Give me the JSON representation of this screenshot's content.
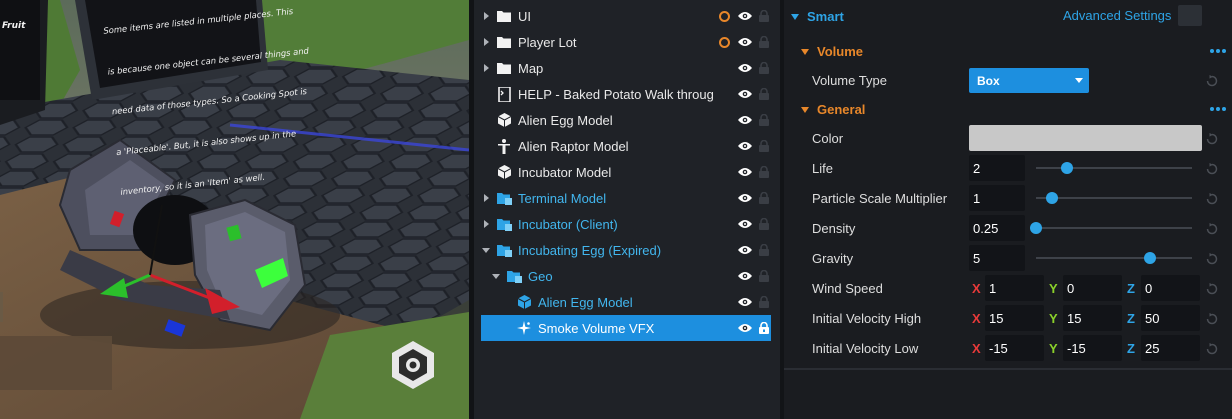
{
  "viewport": {
    "sign_lines": [
      "Some items are listed in multiple places. This",
      "is because one object can be several things and",
      "need data of those types. So a Cooking Spot is",
      "a 'Placeable'. But, it is also shows up in the",
      "inventory, so it is an 'Item' as well."
    ],
    "left_sign_fragment": "Fruit"
  },
  "hierarchy": {
    "rows": [
      {
        "label": "UI",
        "icon": "folder-icon",
        "expander": "collapsed",
        "status": "orange-ring",
        "locked": false,
        "blue": false
      },
      {
        "label": "Player Lot",
        "icon": "folder-icon",
        "expander": "collapsed",
        "status": "orange-ring",
        "locked": false,
        "blue": false
      },
      {
        "label": "Map",
        "icon": "folder-icon",
        "expander": "collapsed",
        "status": "",
        "locked": false,
        "blue": false
      },
      {
        "label": "HELP - Baked Potato Walk throug",
        "icon": "script-icon",
        "expander": "none",
        "status": "",
        "locked": false,
        "blue": false
      },
      {
        "label": "Alien Egg Model",
        "icon": "cube-icon",
        "expander": "none",
        "status": "",
        "locked": false,
        "blue": false
      },
      {
        "label": "Alien Raptor Model",
        "icon": "figure-icon",
        "expander": "none",
        "status": "",
        "locked": false,
        "blue": false
      },
      {
        "label": "Incubator Model",
        "icon": "cube-icon",
        "expander": "none",
        "status": "",
        "locked": false,
        "blue": false
      },
      {
        "label": "Terminal Model",
        "icon": "template-folder-icon",
        "expander": "collapsed",
        "status": "",
        "locked": false,
        "blue": true
      },
      {
        "label": "Incubator (Client)",
        "icon": "template-folder-icon",
        "expander": "collapsed",
        "status": "",
        "locked": false,
        "blue": true
      },
      {
        "label": "Incubating Egg (Expired)",
        "icon": "template-folder-icon",
        "expander": "expanded",
        "status": "",
        "locked": false,
        "blue": true
      },
      {
        "label": "Geo",
        "icon": "template-folder-icon",
        "expander": "expanded",
        "status": "",
        "locked": false,
        "blue": true
      },
      {
        "label": "Alien Egg Model",
        "icon": "cube-icon",
        "expander": "none",
        "status": "",
        "locked": false,
        "blue": true
      },
      {
        "label": "Smoke Volume VFX",
        "icon": "sparkle-icon",
        "expander": "none",
        "status": "",
        "locked": true,
        "blue": false,
        "selected": true
      }
    ]
  },
  "properties": {
    "smart_title": "Smart",
    "advanced_settings": "Advanced Settings",
    "volume_section": "Volume",
    "volume_type_label": "Volume Type",
    "volume_type_value": "Box",
    "general_section": "General",
    "color_label": "Color",
    "color_value": "#c8c8c8",
    "life_label": "Life",
    "life_value": "2",
    "life_slider": 0.2,
    "scale_label": "Particle Scale Multiplier",
    "scale_value": "1",
    "scale_slider": 0.1,
    "density_label": "Density",
    "density_value": "0.25",
    "density_slider": 0.0,
    "gravity_label": "Gravity",
    "gravity_value": "5",
    "gravity_slider": 0.73,
    "wind_label": "Wind Speed",
    "wind": {
      "x": "1",
      "y": "0",
      "z": "0"
    },
    "vel_high_label": "Initial Velocity High",
    "vel_high": {
      "x": "15",
      "y": "15",
      "z": "50"
    },
    "vel_low_label": "Initial Velocity Low",
    "vel_low": {
      "x": "-15",
      "y": "-15",
      "z": "25"
    },
    "axis_x": "X",
    "axis_y": "Y",
    "axis_z": "Z"
  },
  "colors": {
    "accent_blue": "#2ea4e6",
    "selection_blue": "#1d8fdf",
    "orange": "#e8872a",
    "axis_x": "#e83a3a",
    "axis_y": "#8bd12a",
    "axis_z": "#2ea4e6"
  }
}
